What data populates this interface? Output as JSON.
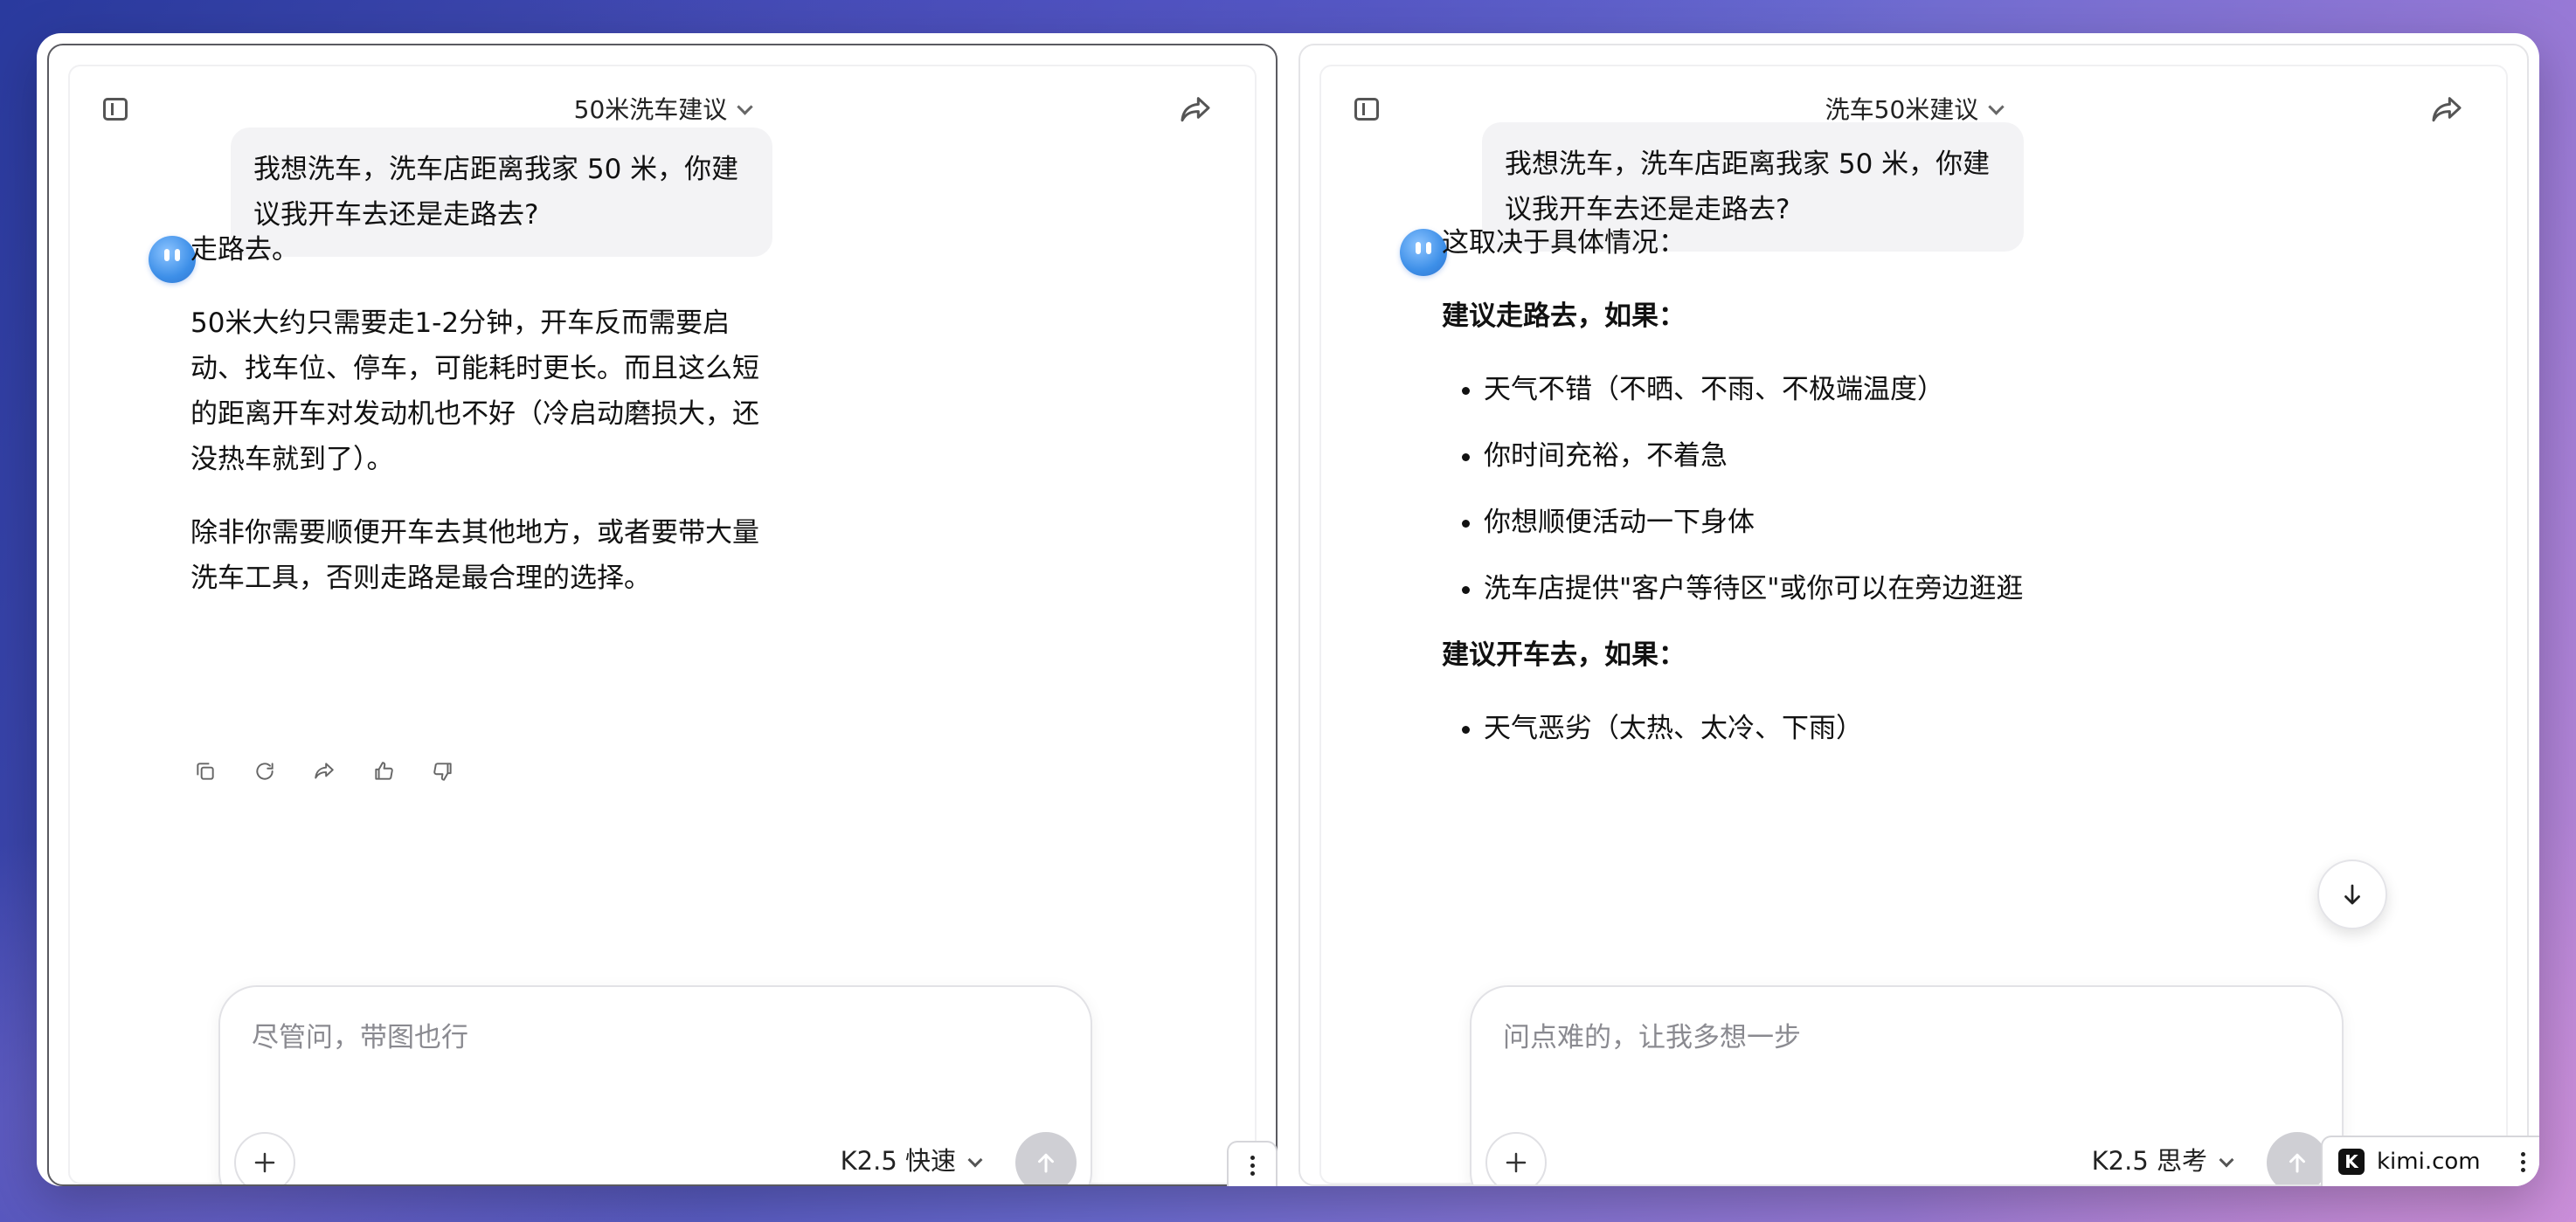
{
  "left": {
    "title": "50米洗车建议",
    "user_message": "我想洗车，洗车店距离我家 50 米，你建议我开车去还是走路去?",
    "answer": {
      "p1": "走路去。",
      "p2": "50米大约只需要走1-2分钟，开车反而需要启动、找车位、停车，可能耗时更长。而且这么短的距离开车对发动机也不好（冷启动磨损大，还没热车就到了）。",
      "p3": "除非你需要顺便开车去其他地方，或者要带大量洗车工具，否则走路是最合理的选择。"
    },
    "actions": [
      "copy-icon",
      "regenerate-icon",
      "share-icon",
      "thumbs-up-icon",
      "thumbs-down-icon"
    ],
    "composer": {
      "placeholder": "尽管问，带图也行",
      "model": "K2.5 快速"
    }
  },
  "right": {
    "title": "洗车50米建议",
    "user_message": "我想洗车，洗车店距离我家 50 米，你建议我开车去还是走路去?",
    "answer": {
      "intro": "这取决于具体情况：",
      "walk_heading": "建议走路去，如果：",
      "walk_items": [
        "天气不错（不晒、不雨、不极端温度）",
        "你时间充裕，不着急",
        "你想顺便活动一下身体",
        "洗车店提供\"客户等待区\"或你可以在旁边逛逛"
      ],
      "drive_heading": "建议开车去，如果：",
      "drive_items": [
        "天气恶劣（太热、太冷、下雨）"
      ]
    },
    "composer": {
      "placeholder": "问点难的，让我多想一步",
      "model": "K2.5 思考"
    }
  },
  "watermark": {
    "logo": "K",
    "text": "kimi.com"
  }
}
